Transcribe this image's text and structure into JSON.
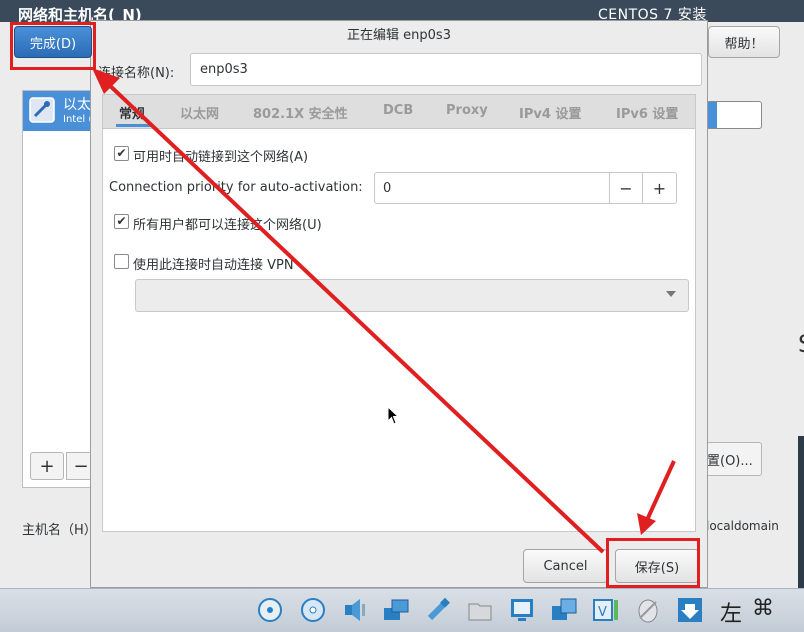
{
  "installer": {
    "title": "网络和主机名(_N)",
    "product": "CENTOS 7 安装",
    "done_label": "完成(D)",
    "help_label": "帮助！",
    "device_name": "以太",
    "device_sub": "Intel (",
    "add_label": "+",
    "remove_label": "−",
    "hostname_label": "主机名（H）",
    "configure_label": "置(O)...",
    "domain_text": "localdomain",
    "right_glyph": "S"
  },
  "dialog": {
    "title": "正在编辑 enp0s3",
    "connection_name_label": "连接名称(N):",
    "connection_name_value": "enp0s3",
    "tabs": [
      {
        "label": "常规"
      },
      {
        "label": "以太网"
      },
      {
        "label": "802.1X 安全性"
      },
      {
        "label": "DCB"
      },
      {
        "label": "Proxy"
      },
      {
        "label": "IPv4 设置"
      },
      {
        "label": "IPv6 设置"
      }
    ],
    "auto_connect_label": "可用时自动链接到这个网络(A)",
    "auto_connect_checked": true,
    "priority_label": "Connection priority for auto-activation:",
    "priority_value": "0",
    "minus_label": "−",
    "plus_label": "+",
    "all_users_label": "所有用户都可以连接这个网络(U)",
    "all_users_checked": true,
    "vpn_label": "使用此连接时自动连接 VPN",
    "vpn_checked": false,
    "cancel_label": "Cancel",
    "save_label": "保存(S)"
  },
  "taskbar": {
    "icons": [
      "hard-disk-icon",
      "optical-disk-icon",
      "audio-icon",
      "network-icon",
      "usb-icon",
      "shared-folder-icon",
      "display-icon",
      "drag-drop-icon",
      "vbox-recording-icon",
      "mouse-integration-icon",
      "download-arrow-icon"
    ],
    "host_key_text": "左",
    "cmd_text": "⌘"
  },
  "colors": {
    "highlight": "#e02020",
    "accent": "#4a90d9"
  }
}
